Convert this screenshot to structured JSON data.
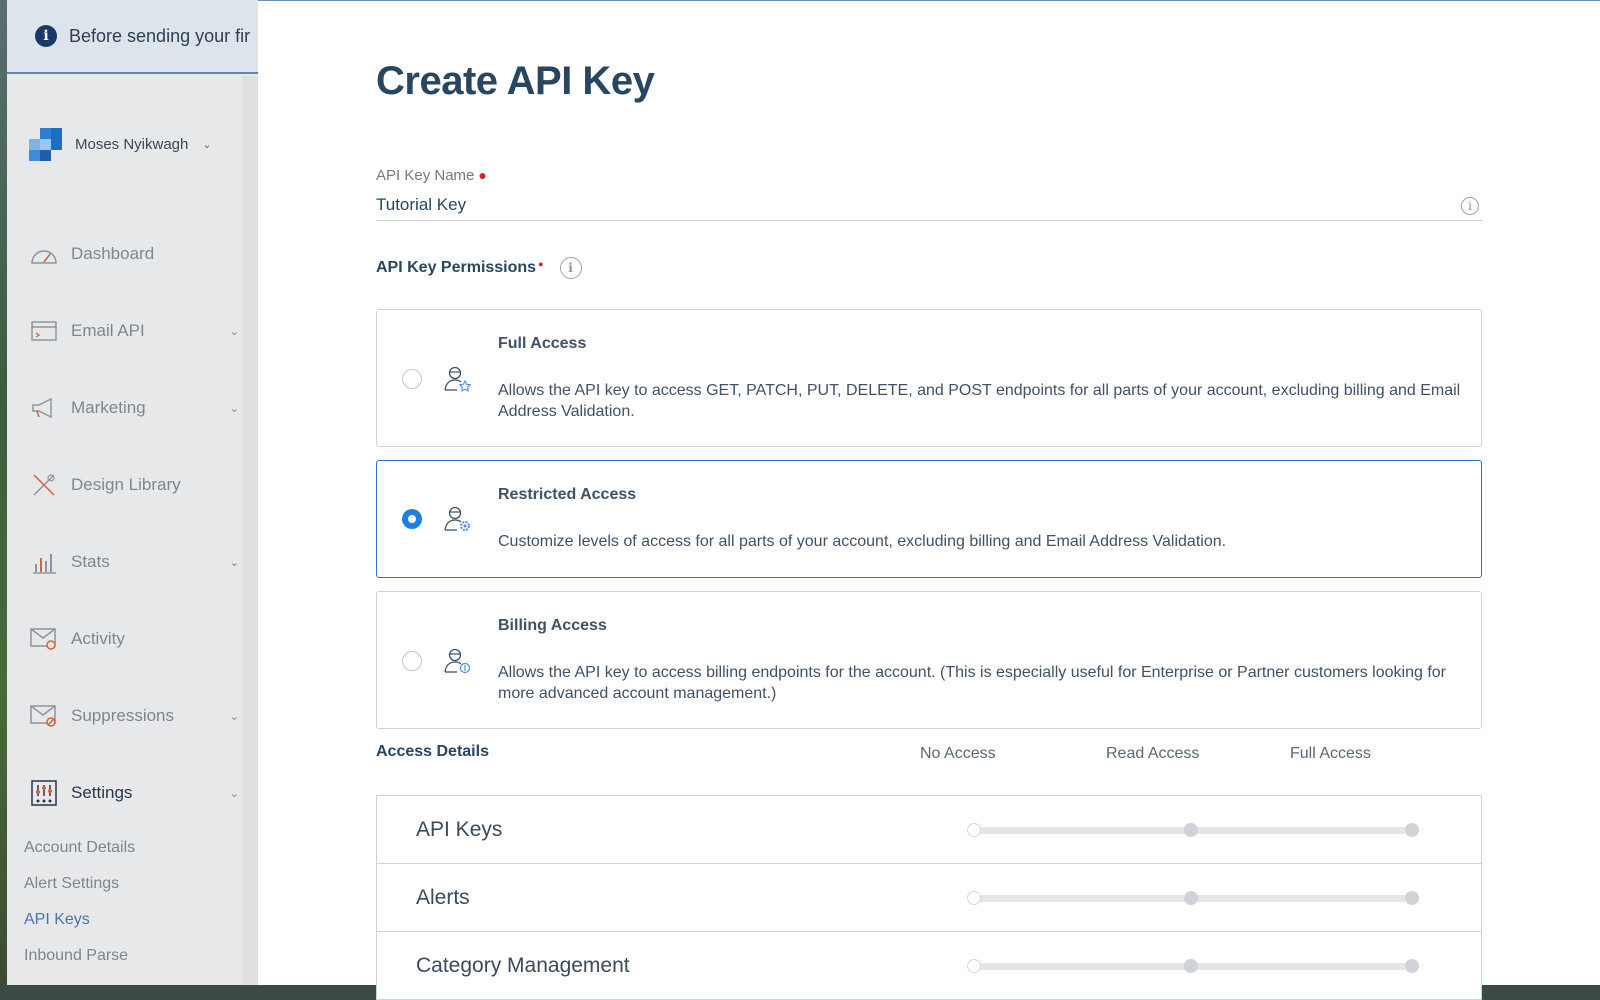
{
  "banner": {
    "text": "Before sending your fir",
    "icon": "info-icon"
  },
  "account": {
    "name": "Moses Nyikwagh"
  },
  "nav": [
    {
      "label": "Dashboard",
      "icon": "dashboard-icon",
      "has_chevron": false
    },
    {
      "label": "Email API",
      "icon": "email-api-icon",
      "has_chevron": true
    },
    {
      "label": "Marketing",
      "icon": "megaphone-icon",
      "has_chevron": true
    },
    {
      "label": "Design Library",
      "icon": "design-icon",
      "has_chevron": false
    },
    {
      "label": "Stats",
      "icon": "stats-icon",
      "has_chevron": true
    },
    {
      "label": "Activity",
      "icon": "activity-icon",
      "has_chevron": false
    },
    {
      "label": "Suppressions",
      "icon": "suppressions-icon",
      "has_chevron": true
    },
    {
      "label": "Settings",
      "icon": "settings-icon",
      "has_chevron": true,
      "active": true
    }
  ],
  "settings_sub": [
    "Account Details",
    "Alert Settings",
    "API Keys",
    "Inbound Parse"
  ],
  "settings_active": "API Keys",
  "page": {
    "title": "Create API Key",
    "name_label": "API Key Name",
    "name_value": "Tutorial Key",
    "permissions_label": "API Key Permissions"
  },
  "options": [
    {
      "title": "Full Access",
      "desc": "Allows the API key to access GET, PATCH, PUT, DELETE, and POST endpoints for all parts of your account, excluding billing and Email Address Validation.",
      "selected": false
    },
    {
      "title": "Restricted Access",
      "desc": "Customize levels of access for all parts of your account, excluding billing and Email Address Validation.",
      "selected": true
    },
    {
      "title": "Billing Access",
      "desc": "Allows the API key to access billing endpoints for the account. (This is especially useful for Enterprise or Partner customers looking for more advanced account management.)",
      "selected": false
    }
  ],
  "access": {
    "header": "Access Details",
    "levels": [
      "No Access",
      "Read Access",
      "Full Access"
    ],
    "rows": [
      "API Keys",
      "Alerts",
      "Category Management"
    ]
  },
  "colors": {
    "accent": "#1a82e2",
    "heading": "#294661",
    "active_sub": "#4b73b0"
  }
}
